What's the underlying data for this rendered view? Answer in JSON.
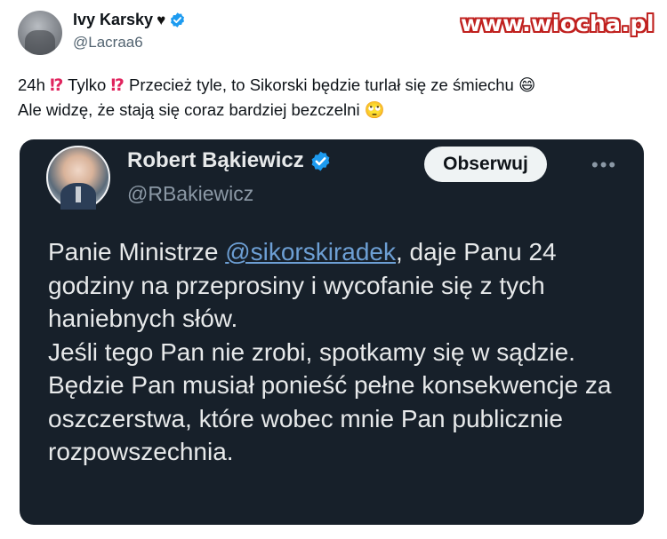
{
  "post": {
    "author_name": "Ivy Karsky",
    "author_handle": "@Lacraa6",
    "line1_a": "24h",
    "line1_b": "Tylko",
    "line1_c": "Przecież tyle, to Sikorski będzie turlał się ze śmiechu",
    "line2": "Ale widzę, że stają się coraz bardziej bezczelni",
    "emoji_interrobang": "⁉",
    "emoji_laugh": "😄",
    "emoji_eyeroll": "🙄"
  },
  "watermark": "www.wiocha.pl",
  "quoted": {
    "author_name": "Robert Bąkiewicz",
    "author_handle": "@RBakiewicz",
    "follow_label": "Obserwuj",
    "more_label": "•••",
    "text_before": "Panie Ministrze ",
    "mention": "@sikorskiradek",
    "text_after": ", daje Panu 24 godziny na przeprosiny i wycofanie się z tych haniebnych słów.",
    "text_para2": "Jeśli tego Pan nie zrobi, spotkamy się w sądzie. Będzie Pan musiał ponieść pełne konsekwencje za oszczerstwa, które wobec mnie Pan publicznie rozpowszechnia."
  },
  "colors": {
    "verified": "#1d9bf0",
    "card_bg": "#17202a",
    "mention": "#6d9fd4",
    "watermark_outline": "#c0211f"
  },
  "icons": {
    "heart": "black-heart-icon",
    "verified": "verified-badge-icon",
    "more": "more-options-icon"
  }
}
